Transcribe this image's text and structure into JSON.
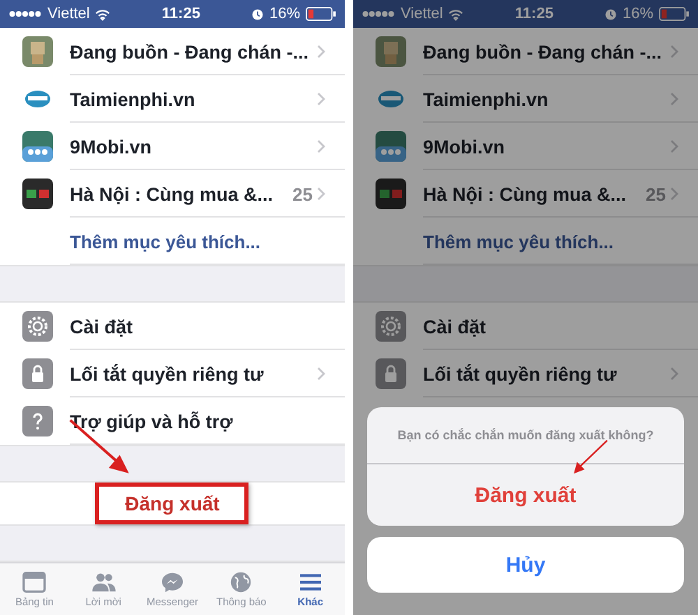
{
  "screens": [
    {
      "dimmed": false,
      "status_bar": {
        "carrier": "Viettel",
        "time": "11:25",
        "battery": "16%"
      },
      "favorites": [
        {
          "name": "Đang buồn - Đang chán -...",
          "chevron": true
        },
        {
          "name": "Taimienphi.vn",
          "chevron": true
        },
        {
          "name": "9Mobi.vn",
          "chevron": true
        },
        {
          "name": "Hà Nội : Cùng mua &...",
          "count": "25",
          "chevron": true
        }
      ],
      "add_favorite": "Thêm mục yêu thích...",
      "settings": [
        {
          "kind": "gear",
          "label": "Cài đặt",
          "chevron": false
        },
        {
          "kind": "lock",
          "label": "Lối tắt quyền riêng tư",
          "chevron": true
        },
        {
          "kind": "help",
          "label": "Trợ giúp và hỗ trợ",
          "chevron": false
        }
      ],
      "logout": "Đăng xuất",
      "tabs": [
        {
          "kind": "feed",
          "label": "Bảng tin",
          "selected": false
        },
        {
          "kind": "friends",
          "label": "Lời mời",
          "selected": false
        },
        {
          "kind": "messenger",
          "label": "Messenger",
          "selected": false
        },
        {
          "kind": "globe",
          "label": "Thông báo",
          "selected": false
        },
        {
          "kind": "menu",
          "label": "Khác",
          "selected": true
        }
      ]
    },
    {
      "dimmed": true,
      "status_bar": {
        "carrier": "Viettel",
        "time": "11:25",
        "battery": "16%"
      },
      "favorites": [
        {
          "name": "Đang buồn - Đang chán -...",
          "chevron": true
        },
        {
          "name": "Taimienphi.vn",
          "chevron": true
        },
        {
          "name": "9Mobi.vn",
          "chevron": true
        },
        {
          "name": "Hà Nội : Cùng mua &...",
          "count": "25",
          "chevron": true
        }
      ],
      "add_favorite": "Thêm mục yêu thích...",
      "settings": [
        {
          "kind": "gear",
          "label": "Cài đặt",
          "chevron": false
        },
        {
          "kind": "lock",
          "label": "Lối tắt quyền riêng tư",
          "chevron": true
        }
      ],
      "action_sheet": {
        "message": "Bạn có chắc chắn muốn đăng xuất không?",
        "confirm": "Đăng xuất",
        "cancel": "Hủy"
      }
    }
  ]
}
